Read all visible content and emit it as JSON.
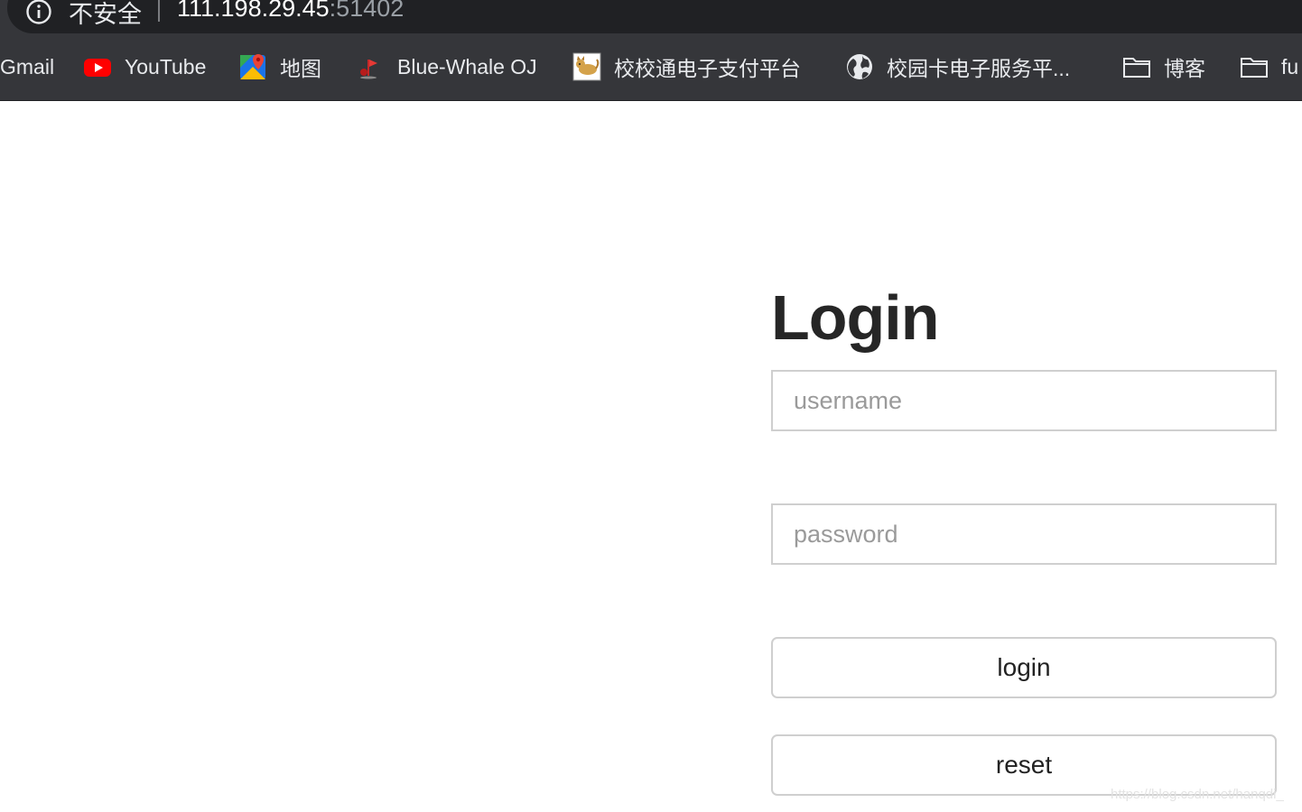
{
  "browser": {
    "security_label": "不安全",
    "url_host": "111.198.29.45",
    "url_port": ":51402",
    "bookmarks": [
      {
        "label": "Gmail",
        "icon": "none"
      },
      {
        "label": "YouTube",
        "icon": "youtube-icon"
      },
      {
        "label": "地图",
        "icon": "google-maps-icon"
      },
      {
        "label": "Blue-Whale OJ",
        "icon": "flag-icon"
      },
      {
        "label": "校校通电子支付平台",
        "icon": "tomcat-icon"
      },
      {
        "label": "校园卡电子服务平...",
        "icon": "globe-icon"
      },
      {
        "label": "博客",
        "icon": "folder-icon"
      },
      {
        "label": "fu",
        "icon": "folder-icon"
      }
    ]
  },
  "login": {
    "title": "Login",
    "username_placeholder": "username",
    "password_placeholder": "password",
    "login_label": "login",
    "reset_label": "reset"
  },
  "watermark": "https://blog.csdn.net/hanqdi_",
  "colors": {
    "chrome_bg": "#35363a",
    "omnibox_bg": "#202124",
    "youtube_red": "#ff0000",
    "input_border": "#cfcfcf",
    "title_text": "#262626"
  }
}
